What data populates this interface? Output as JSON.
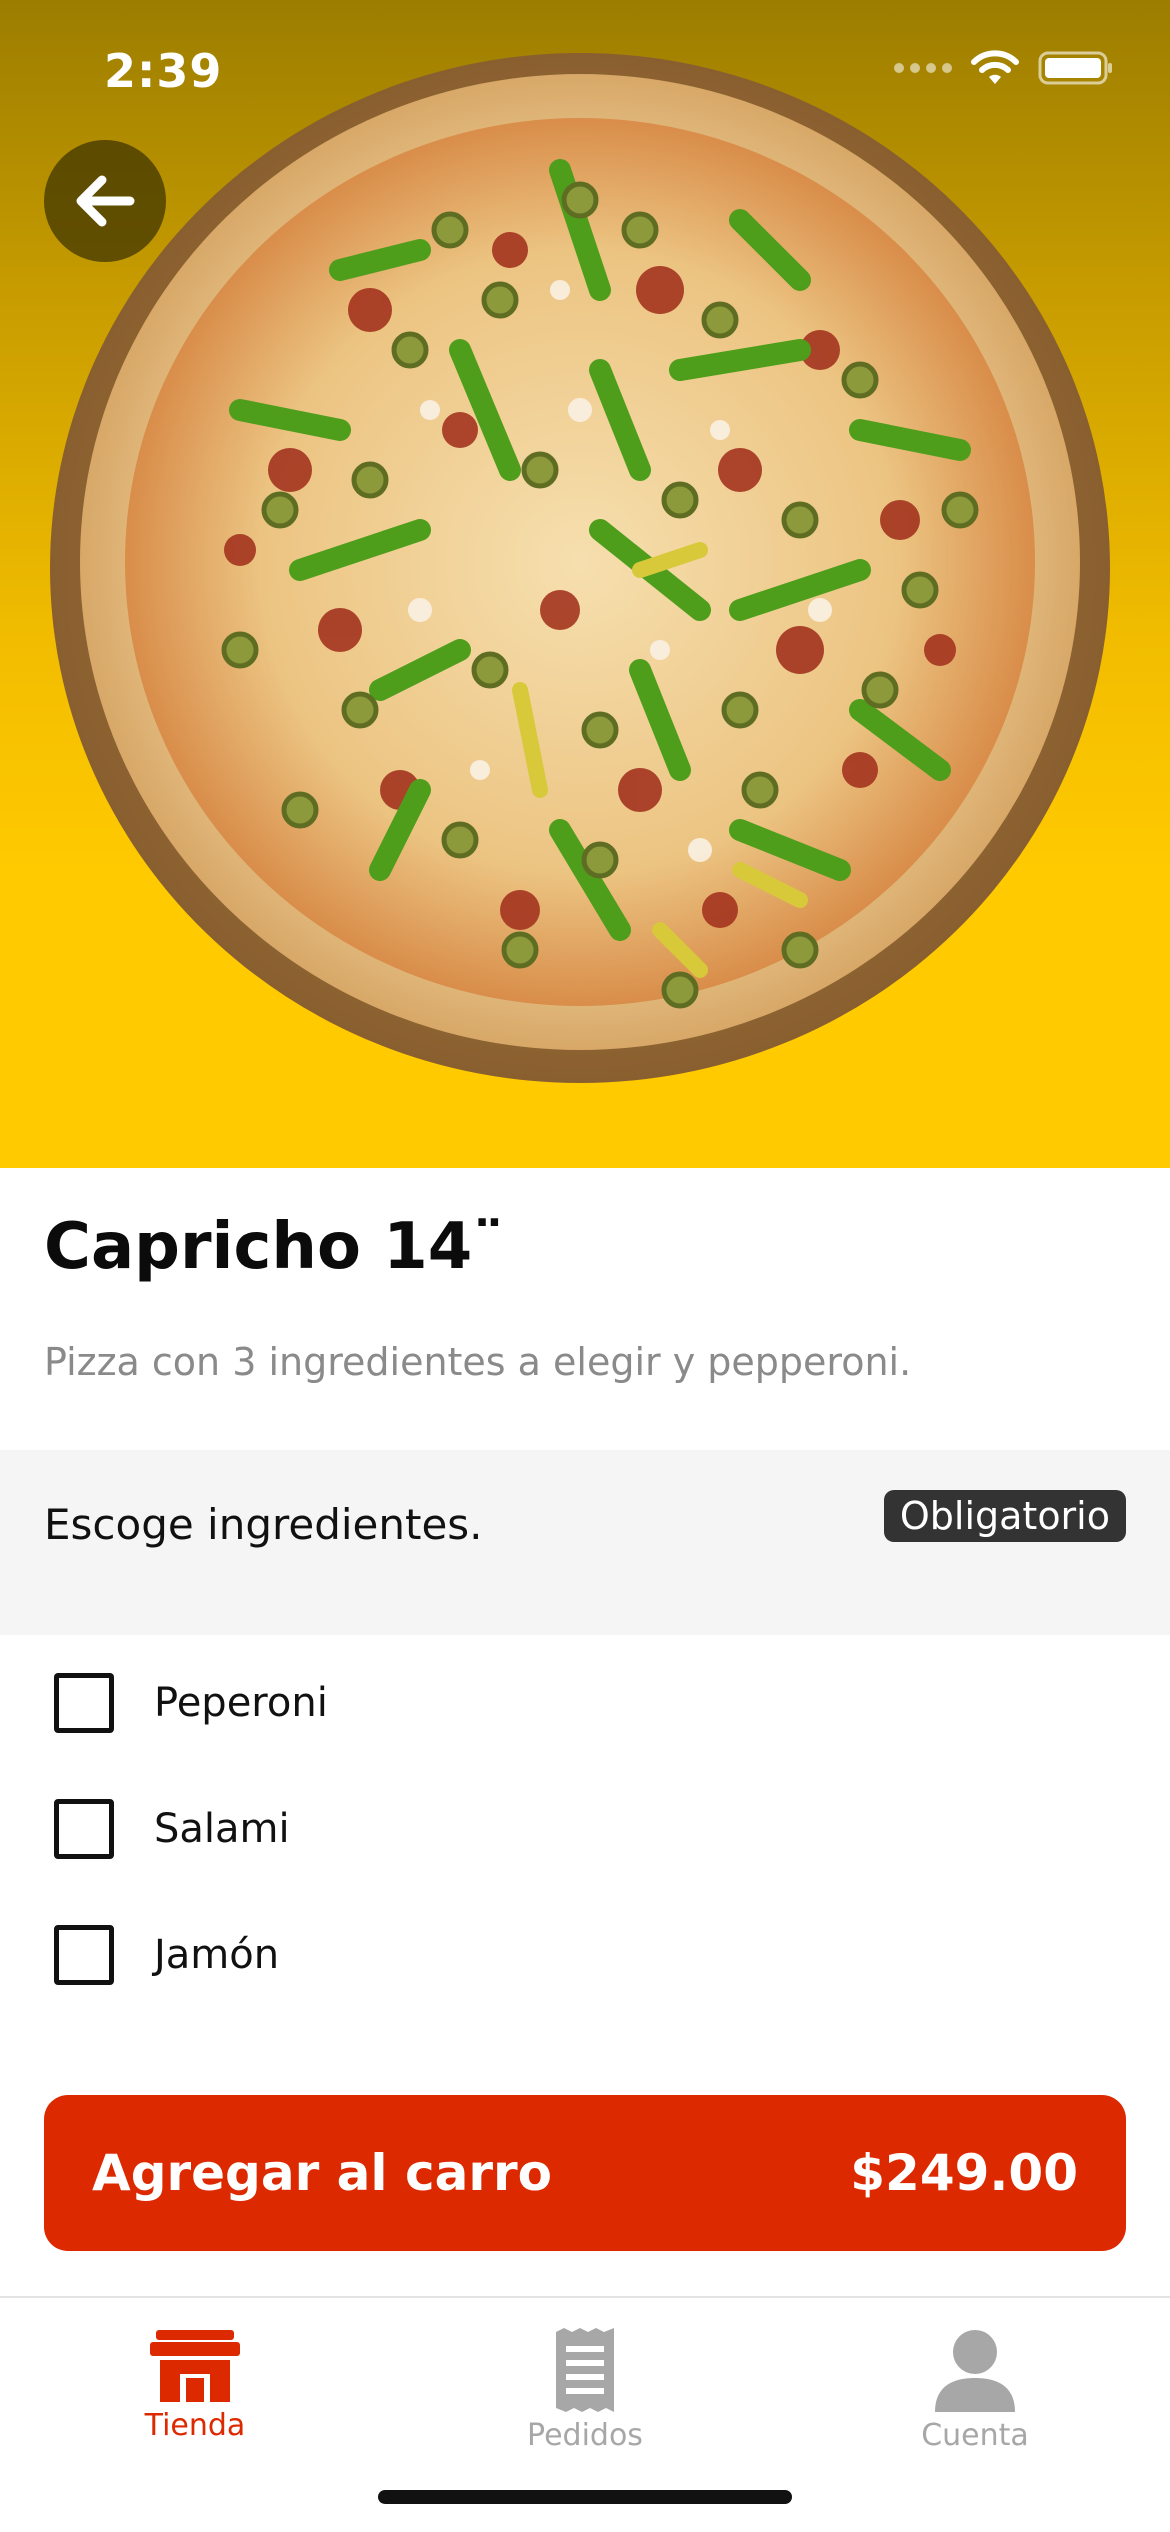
{
  "status_bar": {
    "time": "2:39"
  },
  "product": {
    "title": "Capricho 14¨",
    "description": "Pizza con 3 ingredientes a elegir y pepperoni."
  },
  "section": {
    "title": "Escoge ingredientes.",
    "badge": "Obligatorio"
  },
  "options": [
    {
      "label": "Peperoni",
      "checked": false
    },
    {
      "label": "Salami",
      "checked": false
    },
    {
      "label": "Jamón",
      "checked": false
    }
  ],
  "cart_button": {
    "label": "Agregar al carro",
    "price": "$249.00"
  },
  "tabs": [
    {
      "label": "Tienda",
      "icon": "store-icon",
      "active": true
    },
    {
      "label": "Pedidos",
      "icon": "receipt-icon",
      "active": false
    },
    {
      "label": "Cuenta",
      "icon": "person-icon",
      "active": false
    }
  ],
  "colors": {
    "accent": "#dd2900",
    "hero_yellow": "#ffca00",
    "badge_bg": "#333333",
    "inactive": "#a7a7a7"
  }
}
